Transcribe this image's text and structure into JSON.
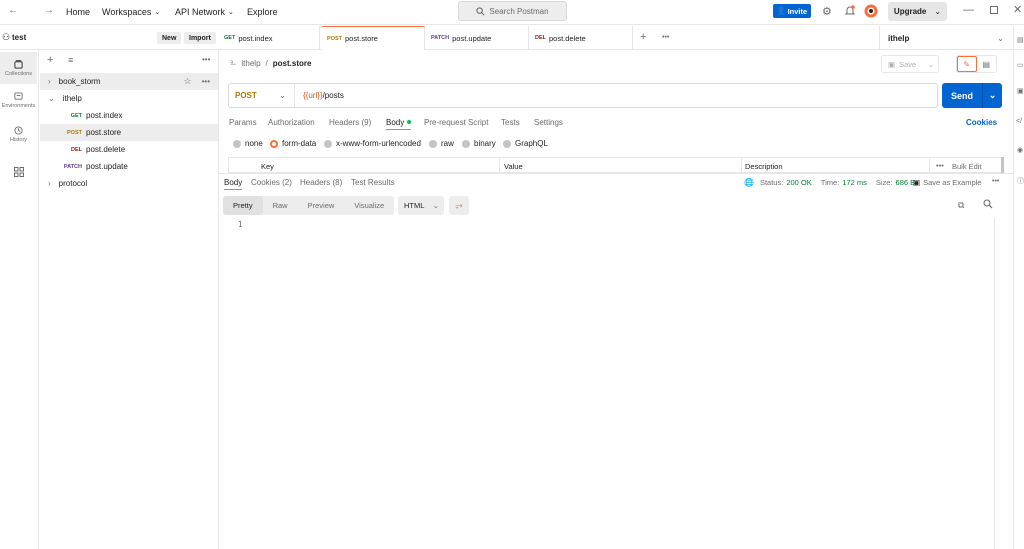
{
  "topbar": {
    "nav": [
      "Home",
      "Workspaces",
      "API Network",
      "Explore"
    ],
    "search_placeholder": "Search Postman",
    "invite": "Invite",
    "upgrade": "Upgrade"
  },
  "workspace": {
    "name": "test",
    "new": "New",
    "import": "Import"
  },
  "rail": [
    "Collections",
    "Environments",
    "History"
  ],
  "tree": {
    "c1": "book_storm",
    "c2": "ithelp",
    "c3": "protocol",
    "items": [
      {
        "method": "GET",
        "name": "post.index"
      },
      {
        "method": "POST",
        "name": "post.store"
      },
      {
        "method": "DEL",
        "name": "post.delete"
      },
      {
        "method": "PATCH",
        "name": "post.update"
      }
    ]
  },
  "tabs": [
    {
      "method": "GET",
      "name": "post.index"
    },
    {
      "method": "POST",
      "name": "post.store"
    },
    {
      "method": "PATCH",
      "name": "post.update"
    },
    {
      "method": "DEL",
      "name": "post.delete"
    }
  ],
  "env": "ithelp",
  "request": {
    "collection": "ithelp",
    "sep": "/",
    "name": "post.store",
    "save": "Save",
    "method": "POST",
    "url_var": "{{url}}",
    "url_path": "/posts",
    "send": "Send",
    "cookies": "Cookies",
    "tabs": [
      "Params",
      "Authorization",
      "Headers (9)",
      "Body",
      "Pre-request Script",
      "Tests",
      "Settings"
    ],
    "body_types": [
      "none",
      "form-data",
      "x-www-form-urlencoded",
      "raw",
      "binary",
      "GraphQL"
    ],
    "kv_headers": {
      "key": "Key",
      "value": "Value",
      "desc": "Description",
      "bulk": "Bulk Edit",
      "more": "•••"
    }
  },
  "response": {
    "tabs": [
      "Body",
      "Cookies (2)",
      "Headers (8)",
      "Test Results"
    ],
    "status_label": "Status:",
    "status": "200 OK",
    "time_label": "Time:",
    "time": "172 ms",
    "size_label": "Size:",
    "size": "686 B",
    "save_example": "Save as Example",
    "views": [
      "Pretty",
      "Raw",
      "Preview",
      "Visualize"
    ],
    "format": "HTML",
    "line": "1"
  },
  "colors": {
    "accent": "#ff6c37",
    "primary": "#0265d2",
    "get": "#007f31",
    "post": "#ad7a03",
    "del": "#8e1a10",
    "patch": "#623497"
  }
}
